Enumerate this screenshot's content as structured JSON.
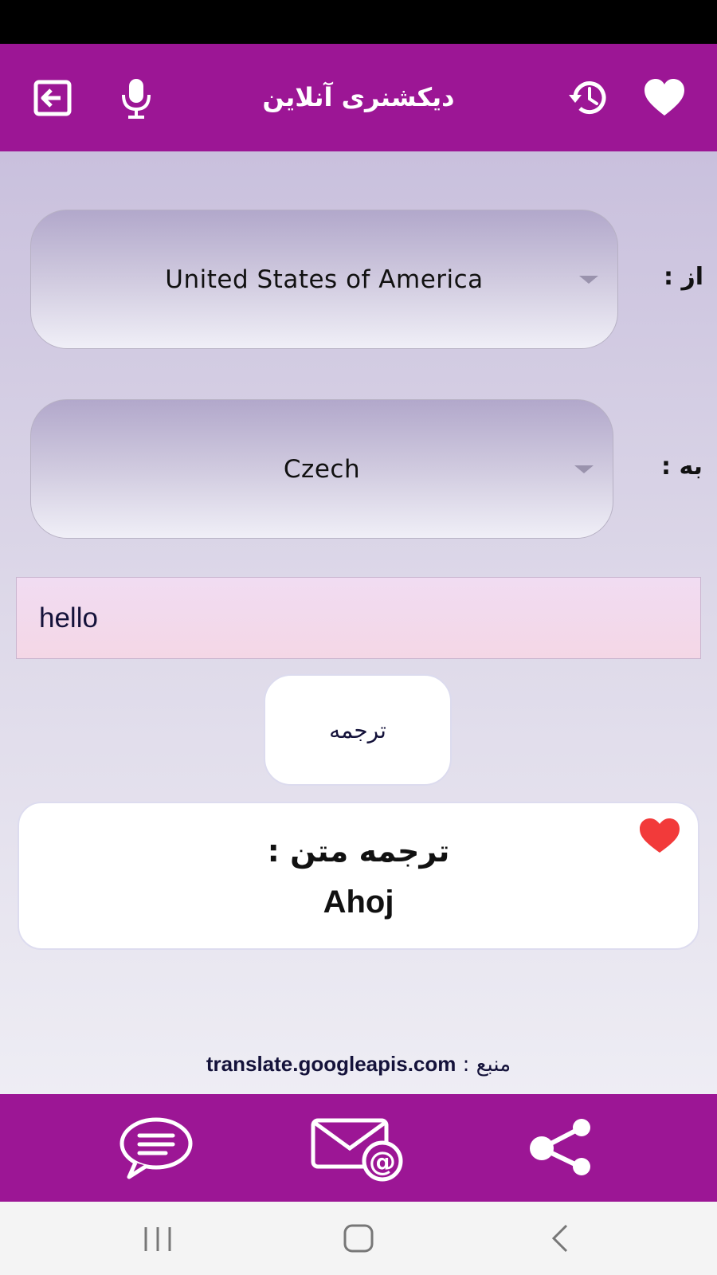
{
  "app_bar": {
    "title": "دیکشنری آنلاین",
    "icons": [
      "exit-icon",
      "mic-icon",
      "history-icon",
      "heart-icon"
    ]
  },
  "from": {
    "label": "از :",
    "value": "United States of America"
  },
  "to": {
    "label": "به :",
    "value": "Czech"
  },
  "input": {
    "value": "hello"
  },
  "translate_button": {
    "label": "ترجمه"
  },
  "result": {
    "label": "ترجمه متن  :",
    "value": "Ahoj"
  },
  "source": {
    "label": "منبع :",
    "domain": "translate.googleapis.com"
  },
  "bottom_bar": {
    "icons": [
      "chat-icon",
      "email-icon",
      "share-icon"
    ]
  },
  "colors": {
    "primary": "#9c1695",
    "heart": "#f23a3a"
  }
}
